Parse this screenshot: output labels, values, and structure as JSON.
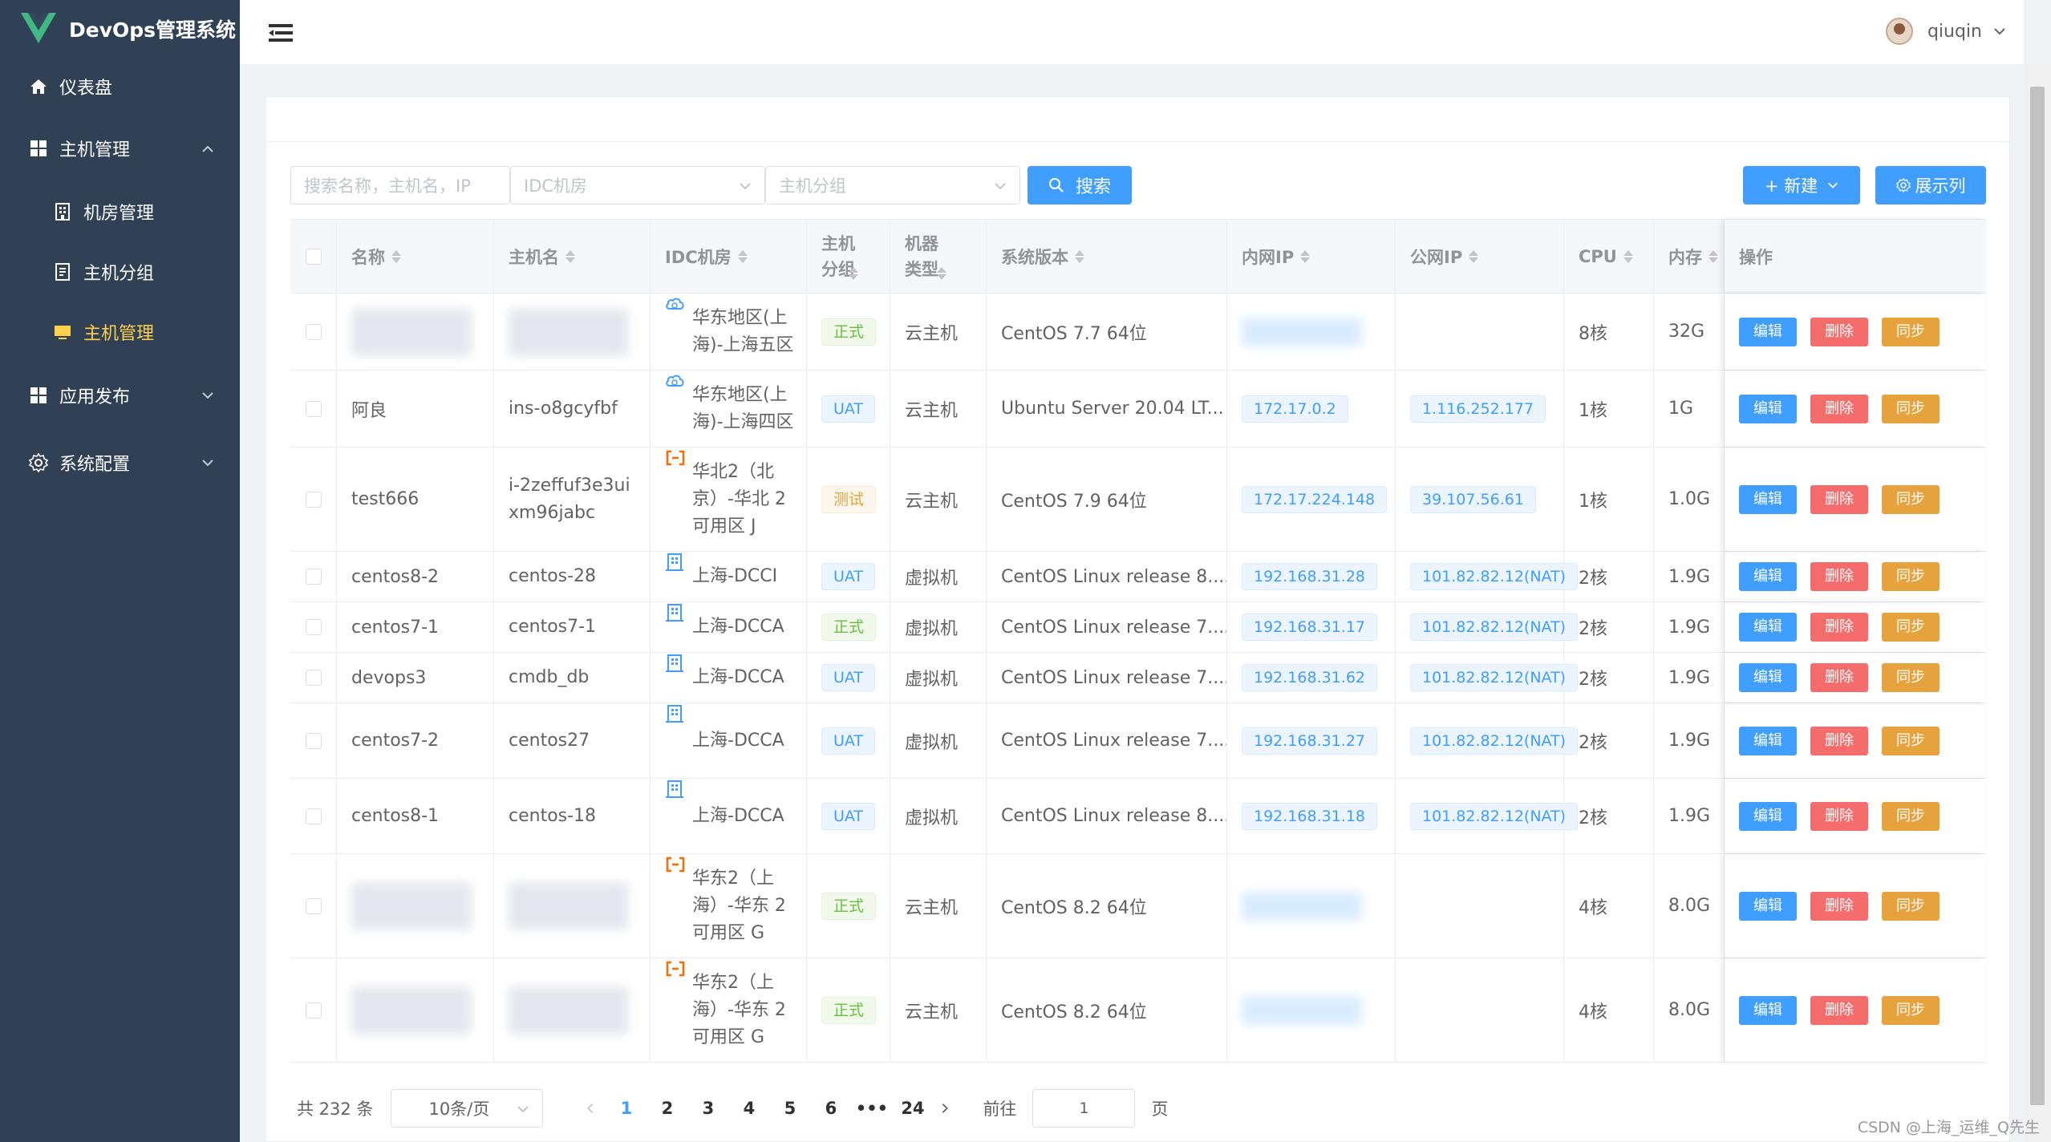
{
  "app": {
    "title": "DevOps管理系统"
  },
  "sidebar": {
    "dashboard": "仪表盘",
    "host_mgmt": "主机管理",
    "sub": [
      "机房管理",
      "主机分组",
      "主机管理"
    ],
    "app_release": "应用发布",
    "sys_config": "系统配置"
  },
  "header": {
    "username": "qiuqin"
  },
  "filter": {
    "search_placeholder": "搜索名称，主机名，IP",
    "idc_placeholder": "IDC机房",
    "group_placeholder": "主机分组",
    "search_btn": "搜索",
    "new_btn": "+ 新建",
    "cols_btn": "展示列"
  },
  "table": {
    "headers": [
      "名称",
      "主机名",
      "IDC机房",
      "主机分组",
      "机器类型",
      "系统版本",
      "内网IP",
      "公网IP",
      "CPU",
      "内存",
      "操作"
    ],
    "actions": {
      "edit": "编辑",
      "delete": "删除",
      "sync": "同步"
    },
    "rows": [
      {
        "name": "",
        "hostname": "",
        "idc": "华东地区(上海)-上海五区",
        "idc_icon": "cloud",
        "group": "正式",
        "group_color": "green",
        "type": "云主机",
        "os": "CentOS 7.7 64位",
        "private_ip": "",
        "public_ip": "",
        "cpu": "8核",
        "mem": "32G",
        "blur": true
      },
      {
        "name": "阿良",
        "hostname": "ins-o8gcyfbf",
        "idc": "华东地区(上海)-上海四区",
        "idc_icon": "cloud",
        "group": "UAT",
        "group_color": "blue",
        "type": "云主机",
        "os": "Ubuntu Server 20.04 LT...",
        "private_ip": "172.17.0.2",
        "public_ip": "1.116.252.177",
        "cpu": "1核",
        "mem": "1G",
        "blur": false
      },
      {
        "name": "test666",
        "hostname": "i-2zeffuf3e3uixm96jabc",
        "idc": "华北2（北京）-华北 2 可用区 J",
        "idc_icon": "aliyun",
        "group": "测试",
        "group_color": "orange",
        "type": "云主机",
        "os": "CentOS 7.9 64位",
        "private_ip": "172.17.224.148",
        "public_ip": "39.107.56.61",
        "cpu": "1核",
        "mem": "1.0G",
        "blur": false
      },
      {
        "name": "centos8-2",
        "hostname": "centos-28",
        "idc": "上海-DCCI",
        "idc_icon": "building",
        "group": "UAT",
        "group_color": "blue",
        "type": "虚拟机",
        "os": "CentOS Linux release 8....",
        "private_ip": "192.168.31.28",
        "public_ip": "101.82.82.12(NAT)",
        "cpu": "2核",
        "mem": "1.9G",
        "blur": false
      },
      {
        "name": "centos7-1",
        "hostname": "centos7-1",
        "idc": "上海-DCCA",
        "idc_icon": "building",
        "group": "正式",
        "group_color": "green",
        "type": "虚拟机",
        "os": "CentOS Linux release 7....",
        "private_ip": "192.168.31.17",
        "public_ip": "101.82.82.12(NAT)",
        "cpu": "2核",
        "mem": "1.9G",
        "blur": false
      },
      {
        "name": "devops3",
        "hostname": "cmdb_db",
        "idc": "上海-DCCA",
        "idc_icon": "building",
        "group": "UAT",
        "group_color": "blue",
        "type": "虚拟机",
        "os": "CentOS Linux release 7....",
        "private_ip": "192.168.31.62",
        "public_ip": "101.82.82.12(NAT)",
        "cpu": "2核",
        "mem": "1.9G",
        "blur": false
      },
      {
        "name": "centos7-2",
        "hostname": "centos27",
        "idc": "上海-DCCA",
        "idc_icon": "building",
        "group": "UAT",
        "group_color": "blue",
        "type": "虚拟机",
        "os": "CentOS Linux release 7....",
        "private_ip": "192.168.31.27",
        "public_ip": "101.82.82.12(NAT)",
        "cpu": "2核",
        "mem": "1.9G",
        "blur": false
      },
      {
        "name": "centos8-1",
        "hostname": "centos-18",
        "idc": "上海-DCCA",
        "idc_icon": "building",
        "group": "UAT",
        "group_color": "blue",
        "type": "虚拟机",
        "os": "CentOS Linux release 8....",
        "private_ip": "192.168.31.18",
        "public_ip": "101.82.82.12(NAT)",
        "cpu": "2核",
        "mem": "1.9G",
        "blur": false
      },
      {
        "name": "",
        "hostname": "",
        "idc": "华东2（上海）-华东 2 可用区 G",
        "idc_icon": "aliyun",
        "group": "正式",
        "group_color": "green",
        "type": "云主机",
        "os": "CentOS 8.2 64位",
        "private_ip": "",
        "public_ip": "",
        "cpu": "4核",
        "mem": "8.0G",
        "blur": true
      },
      {
        "name": "",
        "hostname": "",
        "idc": "华东2（上海）-华东 2 可用区 G",
        "idc_icon": "aliyun",
        "group": "正式",
        "group_color": "green",
        "type": "云主机",
        "os": "CentOS 8.2 64位",
        "private_ip": "",
        "public_ip": "",
        "cpu": "4核",
        "mem": "8.0G",
        "blur": true
      }
    ]
  },
  "pager": {
    "total": "共 232 条",
    "page_size": "10条/页",
    "pages": [
      "1",
      "2",
      "3",
      "4",
      "5",
      "6",
      "•••",
      "24"
    ],
    "goto_label": "前往",
    "goto_value": "1",
    "page_suffix": "页"
  },
  "watermark": "CSDN @上海_运维_Q先生"
}
